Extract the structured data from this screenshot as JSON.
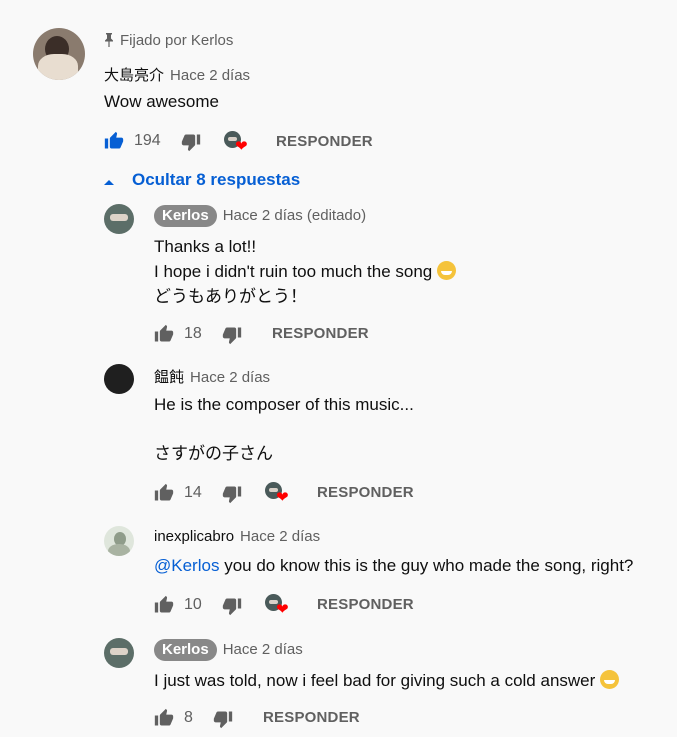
{
  "pinned": {
    "label": "Fijado por Kerlos"
  },
  "top_comment": {
    "author": "大島亮介",
    "time": "Hace 2 días",
    "text": "Wow awesome",
    "likes": "194",
    "reply_label": "RESPONDER"
  },
  "toggle": {
    "label": "Ocultar 8 respuestas"
  },
  "replies": [
    {
      "author": "Kerlos",
      "time": "Hace 2 días (editado)",
      "lines": [
        "Thanks a lot!!",
        "I hope i didn't ruin too much the song",
        "どうもありがとう！"
      ],
      "likes": "18",
      "reply_label": "RESPONDER"
    },
    {
      "author": "饂飩",
      "time": "Hace 2 días",
      "lines": [
        "He is the composer of this music...",
        "さすがの子さん"
      ],
      "likes": "14",
      "reply_label": "RESPONDER"
    },
    {
      "author": "inexplicabro",
      "time": "Hace 2 días",
      "mention": "@Kerlos",
      "text": "you do know this is the guy who made the song, right?",
      "likes": "10",
      "reply_label": "RESPONDER"
    },
    {
      "author": "Kerlos",
      "time": "Hace 2 días",
      "text": "I just was told, now i feel bad for giving such a cold answer",
      "likes": "8",
      "reply_label": "RESPONDER"
    }
  ],
  "colors": {
    "link": "#065fd4",
    "liked": "#065fd4",
    "muted": "#606060",
    "heart": "#ff0000"
  }
}
